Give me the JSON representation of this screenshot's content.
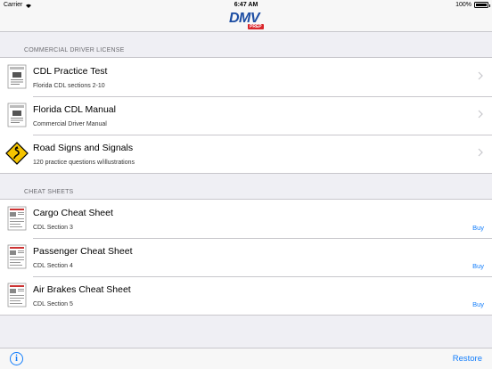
{
  "status_bar": {
    "carrier": "Carrier",
    "time": "6:47 AM",
    "battery": "100%",
    "wifi_icon": "wifi-icon"
  },
  "nav": {
    "logo_text": "DMV",
    "logo_badge": "PREP",
    "brand_color": "#1d4ea3"
  },
  "sections": {
    "cdl": {
      "header": "COMMERCIAL DRIVER LICENSE",
      "items": [
        {
          "title": "CDL Practice Test",
          "subtitle": "Florida CDL sections 2-10",
          "icon": "document-thumbnail-icon"
        },
        {
          "title": "Florida CDL Manual",
          "subtitle": "Commercial Driver Manual",
          "icon": "document-thumbnail-icon"
        },
        {
          "title": "Road Signs and Signals",
          "subtitle": "120 practice questions w/illustrations",
          "icon": "winding-road-sign-icon"
        }
      ]
    },
    "cheat": {
      "header": "CHEAT SHEETS",
      "items": [
        {
          "title": "Cargo Cheat Sheet",
          "subtitle": "CDL Section 3",
          "action": "Buy",
          "icon": "cheat-sheet-thumbnail-icon"
        },
        {
          "title": "Passenger Cheat Sheet",
          "subtitle": "CDL Section 4",
          "action": "Buy",
          "icon": "cheat-sheet-thumbnail-icon"
        },
        {
          "title": "Air Brakes Cheat Sheet",
          "subtitle": "CDL Section 5",
          "action": "Buy",
          "icon": "cheat-sheet-thumbnail-icon"
        }
      ]
    }
  },
  "toolbar": {
    "info_label": "i",
    "restore_label": "Restore"
  },
  "colors": {
    "accent": "#147efb",
    "background": "#efeff4",
    "separator": "#c8c7cc"
  }
}
